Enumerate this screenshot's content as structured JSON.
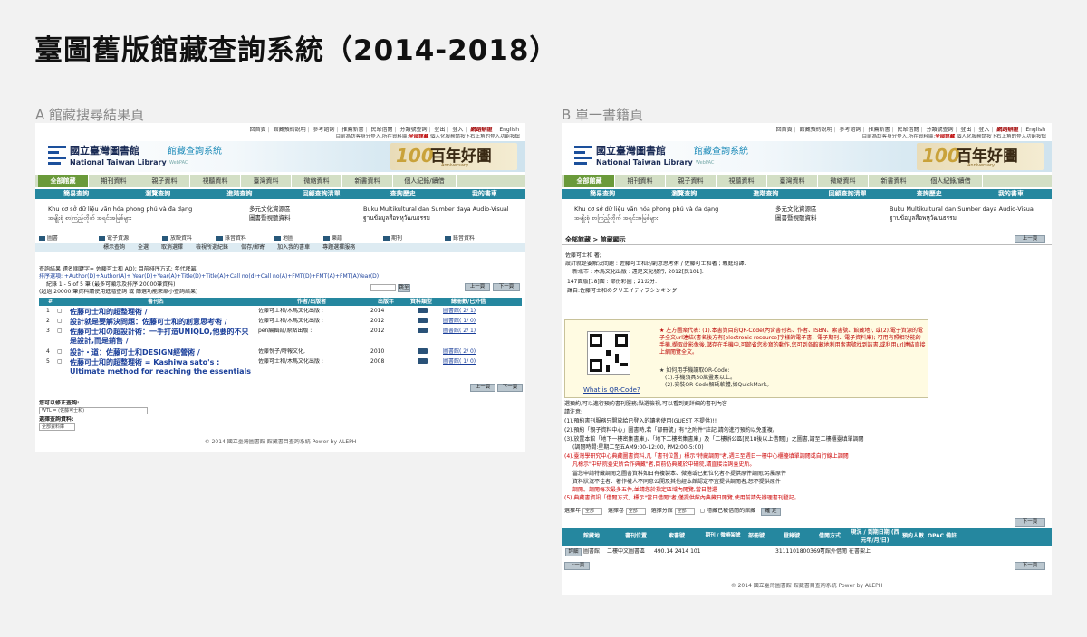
{
  "title": "臺圖舊版館藏查詢系統（2014-2018）",
  "labels": {
    "a": "A 館藏搜尋結果頁",
    "b": "B 單一書籍頁"
  },
  "common": {
    "top_links": [
      "回首頁",
      "館藏預約說明",
      "參考諮詢",
      "推薦新書",
      "民眾借閱",
      "分類號查詢",
      "登出",
      "登入",
      "網路辦證",
      "English"
    ],
    "login_line_prefix": "目前為訪客身分登入,所在資料庫:",
    "login_line_db": "全部館藏",
    "login_line_suffix": "個人化服務請按下右上角的登入功能按鈕",
    "logo_zh": "國立臺灣圖書館",
    "logo_en": "National Taiwan Library",
    "sys_title": "館藏查詢系統",
    "sys_sub": "WebPAC",
    "anniv_num": "100",
    "anniv_zh": "百年好圕",
    "anniv_en": "Anniversary",
    "tabs": [
      "全部館藏",
      "期刊資料",
      "親子資料",
      "視聽資料",
      "臺灣資料",
      "微縮資料",
      "新書資料",
      "個人紀錄/續借"
    ],
    "subnav": [
      "簡易查詢",
      "瀏覽查詢",
      "進階查詢",
      "回顧查詢清單",
      "查詢歷史",
      "我的書車"
    ],
    "multi": {
      "vi": "Khu cơ sở dữ liệu văn hóa phong phú và đa dạng",
      "my": "အမျိုးစုံ စာကြည့်တိုက် အရင်းအမြစ်များ",
      "zh1": "多元文化資源區",
      "zh2": "圖書暨視聽資料",
      "id": "Buku Multikultural dan Sumber daya Audio-Visual",
      "th": "ฐานข้อมูลสื่อพหุวัฒนธรรม"
    },
    "footer": "© 2014 國立臺灣圖書館 館藏書目查詢系統 Power by ALEPH"
  },
  "pageA": {
    "categories": [
      "圖書",
      "電子資源",
      "放映資料",
      "錄音資料",
      "地圖",
      "樂譜",
      "期刊",
      "錄音資料"
    ],
    "func_links": [
      "標示查詢",
      "全選",
      "取消選擇",
      "檢視所選紀錄",
      "儲存/郵寄",
      "加入我的書車",
      "專題選擇服務"
    ],
    "query_line": "查詢結果 題名關鍵字= 佐藤可士和 AD); 目前排序方式: 年代降冪",
    "sort_line": "排序選項: +Author(D)+Author(A)+ Year(D)+Year(A)+Title(D)+Title(A)+Call no(d)+Call no(A)+FMT(D)+FMT(A)+FMT(A)Year(D)",
    "record_line": "紀錄 1 - 5 of 5 筆 (最多可顯示及排序 20000筆資料)",
    "limit_line": "(超過 20000 筆資料請使用進階查詢 或 篩選功能來縮小查詢結果)",
    "jump_btn": "跳至",
    "prev_btn": "上一頁",
    "next_btn": "下一頁",
    "table_headers": [
      "#",
      "書刊名",
      "作者/出版者",
      "出版年",
      "資料類型",
      "總冊數/已外借"
    ],
    "results": [
      {
        "n": "1",
        "title": "佐藤可士和的超整理術 /",
        "author": "佐藤可士和/木馬文化出版 :",
        "year": "2014",
        "holding": "圖書館( 2/ 1)"
      },
      {
        "n": "2",
        "title": "設計就是要解決問題：佐藤可士和的創意思考術 /",
        "author": "佐藤可士和/木馬文化出版 :",
        "year": "2012",
        "holding": "圖書館( 1/ 0)"
      },
      {
        "n": "3",
        "title": "佐藤可士和の超設計術：一手打造UNIQLO,他要的不只是設計,而是銷售 /",
        "author": "pen編輯部/原點出版 :",
        "year": "2012",
        "holding": "圖書館( 2/ 1)"
      },
      {
        "n": "4",
        "title": "設計・道：佐藤可士和DESIGN經營術 /",
        "author": "佐藤悅子/時報文化,",
        "year": "2010",
        "holding": "圖書館( 2/ 0)"
      },
      {
        "n": "5",
        "title": "佐藤可士和的超整理術 = Kashiwa sato's : Ultimate method for reaching the essentials /",
        "author": "佐藤可士和/木馬文化出版 :",
        "year": "2008",
        "holding": "圖書館( 1/ 0)"
      }
    ],
    "correct_label": "您可以修正查詢:",
    "correct_value": "WTL = (佐藤可士和)",
    "db_label": "選擇查詢資料:",
    "db_value": "全部資料庫"
  },
  "pageB": {
    "title_bar": "全部館藏 > 館藏顯示",
    "prev_btn": "上一頁",
    "next_btn": "下一頁",
    "info": [
      "佐藤可士和 著;",
      "設計就是要解決問題 : 佐藤可士和的創意思考術 / 佐藤可士和著 ; 賴庭筠譯.",
      "新北市 : 木馬文化出版 : 遠足文化發行, 2012[民101].",
      "147面版[18]面 : 部份彩圖 ; 21公分.",
      "譯自:佐藤可士和のクリエイティブシンキング"
    ],
    "qr_text": "★ 左方圖案代表: (1).本書資目的QR-Code(內含書刊名、作者、ISBN、索書號、館藏地), 或(2).電子資源的電子全文url連結(書名後方有[electronic resource]字樣的電子書、電子期刊、電子資料庫); 可用有照相功能的手機,擷取此影像後,儲存在手機中,可節省您抄寫的動作,您可到各館藏地利用索書號找到該書,或利用url連結直接上網閱覽全文。",
    "qr_how": "★ 如何用手機讀取QR-Code:",
    "qr_step1": "(1).手機須具30萬畫素以上。",
    "qr_step2": "(2).安裝QR-Code解碼軟體,如QuickMark。",
    "qr_link": "What is QR-Code?",
    "notes": [
      "選預約,可以進行預約書刊服務;點選檢視,可以看到更詳細的書刊內容",
      "請注意:",
      "(1).預約書刊服務只開放給已登入的讀者使用(GUEST 不提供)!!",
      "(2).預約「親子資料中心」圖書時,若「部冊號」有\"之附件\"註記,請勿進行預約以免重複。",
      "(3).放置本館「地下一樓密集書庫」、「地下二樓密集書庫」及「二樓辦公區[民18後以上借閱]」之圖書,請至二樓櫃臺填單調閱",
      "(調閱時間:星期二至五AM9:00-12:00, PM2:00-5:00)",
      "(4).臺灣學研究中心典藏圖書資料,凡「書刊位置」標示\"特藏調閱\"者,週三至週日一樓中心櫃檯填單調閱或自行線上調閱",
      "凡標示\"中研院臺史所合作典藏\"者,目前仍典藏於中研院,請直接洽詢臺史所。",
      "當您申請特藏調閱之圖書資料如日有複製本、微捲或已數位化者不提供原件調閱;另屬原件",
      "資料狀況不佳者、著作權人不同意公開及其他經本館認定不宜提供調閱者,恕不提供原件",
      "調閱。調閱每次最多五件,並請您於指定區域內閱覽,當日借還",
      "(5).典藏書資訊「借閱方式」標示\"當日借閱\"者,僅提供館內典藏日閱覽,使用前請先辦理書刊登記。"
    ],
    "filter_year_label": "選擇年",
    "filter_year": "全部",
    "filter_vol_label": "選擇卷",
    "filter_vol": "全部",
    "filter_branch_label": "選擇分館",
    "filter_branch": "全部",
    "filter_hide": "隱藏已被借閱的館藏",
    "filter_btn": "確 定",
    "holding_headers": [
      "館藏地",
      "書刊位置",
      "索書號",
      "期刊 / 微捲架號",
      "部冊號",
      "登錄號",
      "借閱方式",
      "現況 / 到期日期 (西元年/月/日)",
      "預約人數",
      "OPAC 備註"
    ],
    "holding_row": {
      "detail_btn": "詳細",
      "branch": "圖書館",
      "location": "二樓中文圖書區",
      "callno": "490.14 2414 101",
      "barcode": "31111018003697",
      "loan": "可館外借閱",
      "status": "在書架上"
    }
  }
}
